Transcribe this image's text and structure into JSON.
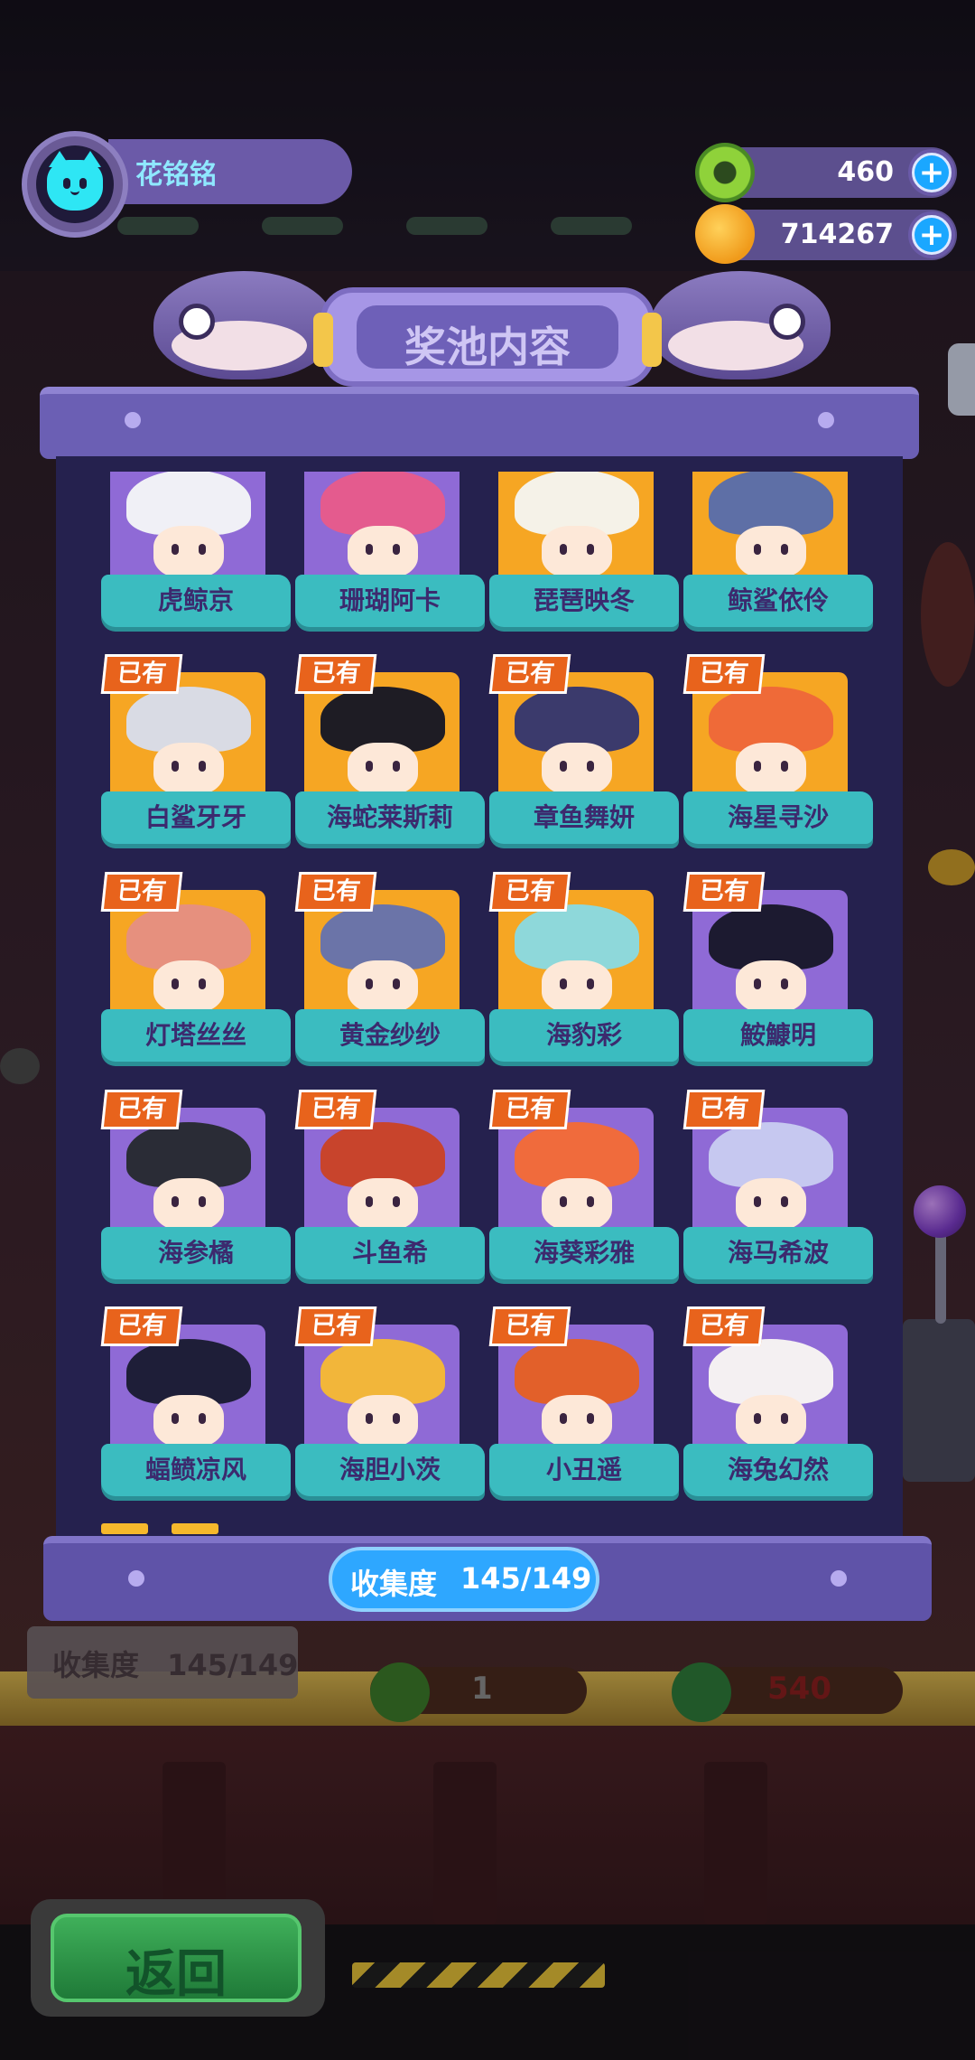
{
  "player": {
    "name": "花铭铭",
    "avatar_icon": "cyan-cat-icon"
  },
  "currencies": [
    {
      "icon": "green-donut-coin-icon",
      "value": "460",
      "plus": "+"
    },
    {
      "icon": "orange-planet-coin-icon",
      "value": "714267",
      "plus": "+"
    }
  ],
  "panel": {
    "title": "奖池内容",
    "collection_label": "收集度",
    "collection_value": "145/149"
  },
  "owned_badge": "已有",
  "cards": [
    {
      "name": "虎鲸京",
      "owned": false,
      "bg": "purple",
      "hair": "#f0f0f6"
    },
    {
      "name": "珊瑚阿卡",
      "owned": false,
      "bg": "purple",
      "hair": "#e45b8e"
    },
    {
      "name": "琵琶映冬",
      "owned": false,
      "bg": "orange",
      "hair": "#f5f2e8"
    },
    {
      "name": "鲸鲨依伶",
      "owned": false,
      "bg": "orange",
      "hair": "#5e6fa6"
    },
    {
      "name": "白鲨牙牙",
      "owned": true,
      "bg": "orange",
      "hair": "#d9dbe4"
    },
    {
      "name": "海蛇莱斯莉",
      "owned": true,
      "bg": "orange",
      "hair": "#1e1c24"
    },
    {
      "name": "章鱼舞妍",
      "owned": true,
      "bg": "orange",
      "hair": "#3b3a6c"
    },
    {
      "name": "海星寻沙",
      "owned": true,
      "bg": "orange",
      "hair": "#ef6a38"
    },
    {
      "name": "灯塔丝丝",
      "owned": true,
      "bg": "orange",
      "hair": "#e6907e"
    },
    {
      "name": "黄金纱纱",
      "owned": true,
      "bg": "orange",
      "hair": "#6b74a8"
    },
    {
      "name": "海豹彩",
      "owned": true,
      "bg": "orange",
      "hair": "#8ed8da"
    },
    {
      "name": "鮟鱇明",
      "owned": true,
      "bg": "purple",
      "hair": "#1c1a30"
    },
    {
      "name": "海参橘",
      "owned": true,
      "bg": "purple",
      "hair": "#2a2c36"
    },
    {
      "name": "斗鱼希",
      "owned": true,
      "bg": "purple",
      "hair": "#c8442c"
    },
    {
      "name": "海葵彩雅",
      "owned": true,
      "bg": "purple",
      "hair": "#f06b3c"
    },
    {
      "name": "海马希波",
      "owned": true,
      "bg": "purple",
      "hair": "#c6c8f0"
    },
    {
      "name": "蝠鲼凉风",
      "owned": true,
      "bg": "purple",
      "hair": "#1e1e38"
    },
    {
      "name": "海胆小茨",
      "owned": true,
      "bg": "purple",
      "hair": "#f2b63a"
    },
    {
      "name": "小丑遥",
      "owned": true,
      "bg": "purple",
      "hair": "#e2602a"
    },
    {
      "name": "海兔幻然",
      "owned": true,
      "bg": "purple",
      "hair": "#f4f0f2"
    },
    {
      "name": "",
      "owned": true,
      "bg": "purple",
      "hair": "#5a4a40"
    },
    {
      "name": "",
      "owned": true,
      "bg": "purple",
      "hair": "#7a3a34"
    },
    {
      "name": "",
      "owned": true,
      "bg": "purple",
      "hair": "#e4584a"
    },
    {
      "name": "",
      "owned": true,
      "bg": "purple",
      "hair": "#f0e6e0"
    }
  ],
  "background": {
    "collection_label": "收集度",
    "collection_value": "145/149",
    "counter_1": "1",
    "counter_2": "540"
  },
  "back_button": {
    "label": "返回"
  }
}
